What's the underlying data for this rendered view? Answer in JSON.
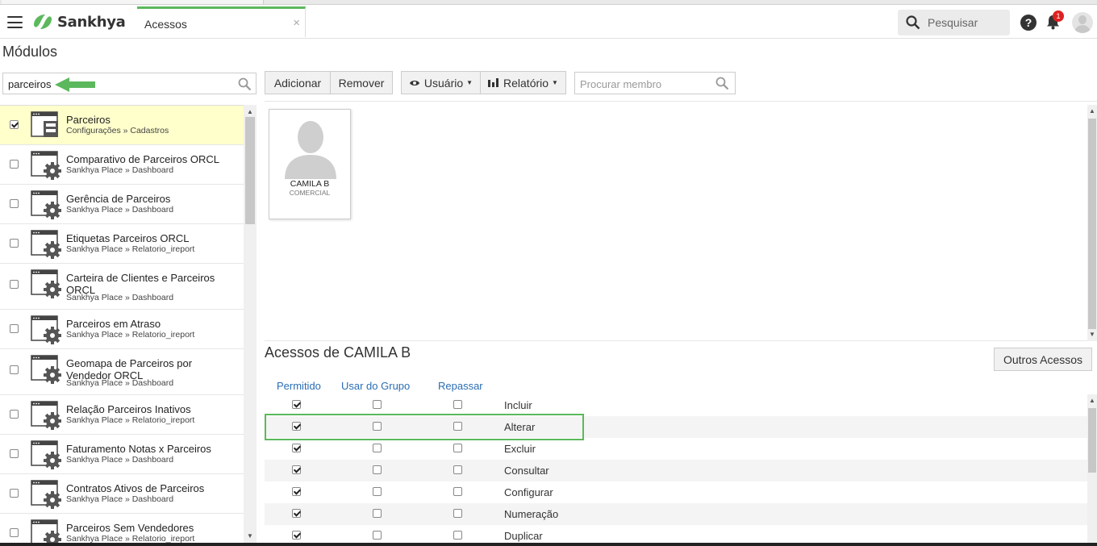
{
  "header": {
    "brand": "Sankhya",
    "tab_label": "Acessos",
    "tab_close": "×",
    "search_placeholder": "Pesquisar",
    "help_label": "?",
    "notification_count": "1",
    "accent_color": "#5cb85c"
  },
  "page": {
    "title": "Módulos"
  },
  "module_search": {
    "value": "parceiros"
  },
  "modules": [
    {
      "name": "Parceiros",
      "path": "Configurações » Cadastros",
      "checked": true,
      "icon": "form-window-icon"
    },
    {
      "name": "Comparativo de Parceiros ORCL",
      "path": "Sankhya Place » Dashboard",
      "checked": false,
      "icon": "gear-window-icon"
    },
    {
      "name": "Gerência de Parceiros",
      "path": "Sankhya Place » Dashboard",
      "checked": false,
      "icon": "gear-window-icon"
    },
    {
      "name": "Etiquetas Parceiros ORCL",
      "path": "Sankhya Place » Relatorio_ireport",
      "checked": false,
      "icon": "gear-window-icon"
    },
    {
      "name": "Carteira de Clientes e Parceiros ORCL",
      "path": "Sankhya Place » Dashboard",
      "checked": false,
      "icon": "gear-window-icon"
    },
    {
      "name": "Parceiros em Atraso",
      "path": "Sankhya Place » Relatorio_ireport",
      "checked": false,
      "icon": "gear-window-icon"
    },
    {
      "name": "Geomapa de Parceiros por Vendedor ORCL",
      "path": "Sankhya Place » Dashboard",
      "checked": false,
      "icon": "gear-window-icon"
    },
    {
      "name": "Relação Parceiros Inativos",
      "path": "Sankhya Place » Relatorio_ireport",
      "checked": false,
      "icon": "gear-window-icon"
    },
    {
      "name": "Faturamento Notas x Parceiros",
      "path": "Sankhya Place » Dashboard",
      "checked": false,
      "icon": "gear-window-icon"
    },
    {
      "name": "Contratos Ativos de Parceiros",
      "path": "Sankhya Place » Dashboard",
      "checked": false,
      "icon": "gear-window-icon"
    },
    {
      "name": "Parceiros Sem Vendedores",
      "path": "Sankhya Place » Relatorio_ireport",
      "checked": false,
      "icon": "gear-window-icon"
    }
  ],
  "toolbar": {
    "add_label": "Adicionar",
    "remove_label": "Remover",
    "user_label": "Usuário",
    "report_label": "Relatório",
    "member_search_placeholder": "Procurar membro"
  },
  "member": {
    "name": "CAMILA B",
    "group": "COMERCIAL"
  },
  "access": {
    "title": "Acessos de CAMILA B",
    "other_button": "Outros Acessos",
    "columns": [
      "Permitido",
      "Usar do Grupo",
      "Repassar"
    ],
    "rows": [
      {
        "label": "Incluir",
        "permitido": true,
        "grupo": false,
        "repassar": false
      },
      {
        "label": "Alterar",
        "permitido": true,
        "grupo": false,
        "repassar": false
      },
      {
        "label": "Excluir",
        "permitido": true,
        "grupo": false,
        "repassar": false
      },
      {
        "label": "Consultar",
        "permitido": true,
        "grupo": false,
        "repassar": false
      },
      {
        "label": "Configurar",
        "permitido": true,
        "grupo": false,
        "repassar": false
      },
      {
        "label": "Numeração",
        "permitido": true,
        "grupo": false,
        "repassar": false
      },
      {
        "label": "Duplicar",
        "permitido": true,
        "grupo": false,
        "repassar": false
      }
    ]
  }
}
